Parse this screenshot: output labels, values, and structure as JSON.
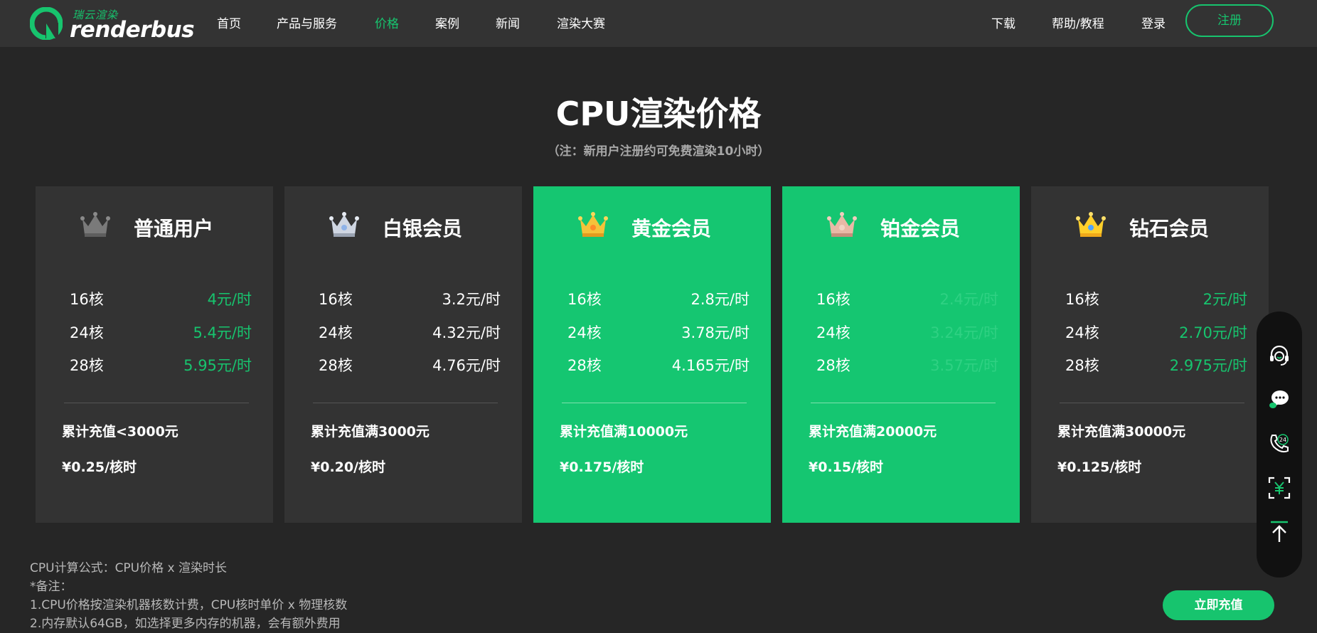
{
  "nav": {
    "logo_cn": "瑞云渲染",
    "logo_en": "renderbus",
    "items": [
      {
        "label": "首页",
        "active": false
      },
      {
        "label": "产品与服务",
        "active": false
      },
      {
        "label": "价格",
        "active": true
      },
      {
        "label": "案例",
        "active": false
      },
      {
        "label": "新闻",
        "active": false
      },
      {
        "label": "渲染大赛",
        "active": false
      }
    ],
    "right_items": [
      {
        "label": "下载"
      },
      {
        "label": "帮助/教程"
      },
      {
        "label": "登录"
      }
    ],
    "register_label": "注册"
  },
  "header": {
    "title": "CPU渲染价格",
    "subtitle": "（注：新用户注册约可免费渲染10小时）"
  },
  "cards": [
    {
      "name": "普通用户",
      "crown_icon": "gray-crown-icon",
      "highlight": false,
      "rows": [
        {
          "core": "16核",
          "price": "4元/时"
        },
        {
          "core": "24核",
          "price": "5.4元/时"
        },
        {
          "core": "28核",
          "price": "5.95元/时"
        }
      ],
      "requirement": "累计充值<3000元",
      "unit_price": "¥0.25/核时",
      "price_color": "#17c46e"
    },
    {
      "name": "白银会员",
      "crown_icon": "silver-crown-icon",
      "highlight": false,
      "rows": [
        {
          "core": "16核",
          "price": "3.2元/时"
        },
        {
          "core": "24核",
          "price": "4.32元/时"
        },
        {
          "core": "28核",
          "price": "4.76元/时"
        }
      ],
      "requirement": "累计充值满3000元",
      "unit_price": "¥0.20/核时",
      "price_color": "#ffffff"
    },
    {
      "name": "黄金会员",
      "crown_icon": "gold-crown-icon",
      "highlight": true,
      "rows": [
        {
          "core": "16核",
          "price": "2.8元/时"
        },
        {
          "core": "24核",
          "price": "3.78元/时"
        },
        {
          "core": "28核",
          "price": "4.165元/时"
        }
      ],
      "requirement": "累计充值满10000元",
      "unit_price": "¥0.175/核时",
      "price_color": "#ffffff"
    },
    {
      "name": "铂金会员",
      "crown_icon": "platinum-crown-icon",
      "highlight": true,
      "rows": [
        {
          "core": "16核",
          "price": "2.4元/时"
        },
        {
          "core": "24核",
          "price": "3.24元/时"
        },
        {
          "core": "28核",
          "price": "3.57元/时"
        }
      ],
      "requirement": "累计充值满20000元",
      "unit_price": "¥0.15/核时",
      "price_color": "#2fd183"
    },
    {
      "name": "钻石会员",
      "crown_icon": "diamond-crown-icon",
      "highlight": false,
      "rows": [
        {
          "core": "16核",
          "price": "2元/时"
        },
        {
          "core": "24核",
          "price": "2.70元/时"
        },
        {
          "core": "28核",
          "price": "2.975元/时"
        }
      ],
      "requirement": "累计充值满30000元",
      "unit_price": "¥0.125/核时",
      "price_color": "#17c46e"
    }
  ],
  "notes": [
    "CPU计算公式：CPU价格 x 渲染时长",
    "*备注：",
    "1.CPU价格按渲染机器核数计费，CPU核时单价 x 物理核数",
    "2.内存默认64GB，如选择更多内存的机器，会有额外费用"
  ],
  "recharge_label": "立即充值",
  "sidebar": [
    "headset-service-icon",
    "wechat-chat-icon",
    "phone-24h-icon",
    "price-scan-icon",
    "back-to-top-icon"
  ],
  "colors": {
    "accent": "#17c46e",
    "background": "#262626",
    "nav_bg": "#333333",
    "card_bg": "#333333",
    "card_highlight": "#15c671"
  }
}
